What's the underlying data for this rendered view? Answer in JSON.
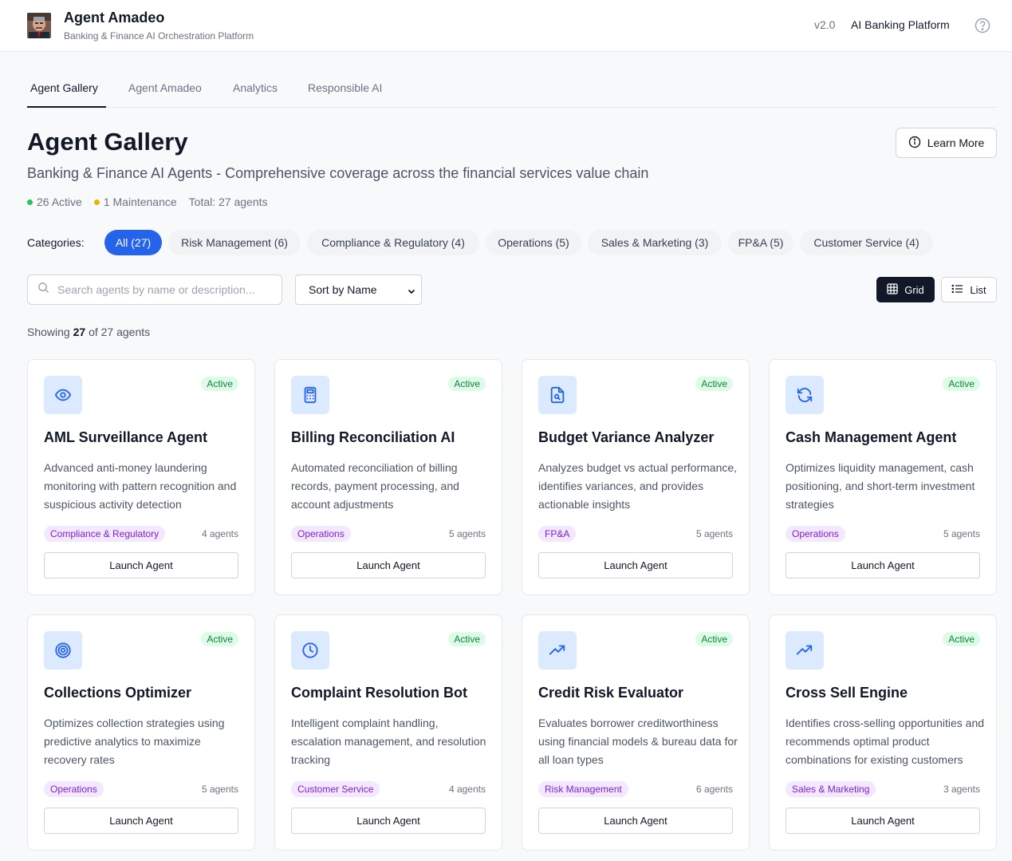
{
  "header": {
    "title": "Agent Amadeo",
    "subtitle": "Banking & Finance AI Orchestration Platform",
    "version": "v2.0",
    "platform": "AI Banking Platform"
  },
  "tabs": [
    {
      "label": "Agent Gallery",
      "active": true
    },
    {
      "label": "Agent Amadeo",
      "active": false
    },
    {
      "label": "Analytics",
      "active": false
    },
    {
      "label": "Responsible AI",
      "active": false
    }
  ],
  "page": {
    "title": "Agent Gallery",
    "description": "Banking & Finance AI Agents - Comprehensive coverage across the financial services value chain",
    "learn_more": "Learn More"
  },
  "stats": {
    "active": "26 Active",
    "maintenance": "1 Maintenance",
    "total": "Total: 27 agents",
    "active_color": "#22c55e",
    "maintenance_color": "#eab308"
  },
  "categories": {
    "label": "Categories:",
    "items": [
      {
        "label": "All (27)",
        "active": true
      },
      {
        "label": "Risk Management (6)",
        "active": false
      },
      {
        "label": "Compliance & Regulatory (4)",
        "active": false
      },
      {
        "label": "Operations (5)",
        "active": false
      },
      {
        "label": "Sales & Marketing (3)",
        "active": false
      },
      {
        "label": "FP&A (5)",
        "active": false
      },
      {
        "label": "Customer Service (4)",
        "active": false
      }
    ]
  },
  "search": {
    "placeholder": "Search agents by name or description...",
    "value": ""
  },
  "sort": {
    "label": "Sort by Name"
  },
  "view": {
    "grid": "Grid",
    "list": "List",
    "selected": "grid"
  },
  "showing": {
    "prefix": "Showing",
    "count": "27",
    "suffix": "of 27 agents"
  },
  "cards": [
    {
      "name": "AML Surveillance Agent",
      "status": "Active",
      "icon": "eye-icon",
      "description": "Advanced anti-money laundering monitoring with pattern recognition and suspicious activity detection",
      "category": "Compliance & Regulatory",
      "agents": "4 agents",
      "button": "Launch Agent"
    },
    {
      "name": "Billing Reconciliation AI",
      "status": "Active",
      "icon": "calculator-icon",
      "description": "Automated reconciliation of billing records, payment processing, and account adjustments",
      "category": "Operations",
      "agents": "5 agents",
      "button": "Launch Agent"
    },
    {
      "name": "Budget Variance Analyzer",
      "status": "Active",
      "icon": "file-search-icon",
      "description": "Analyzes budget vs actual performance, identifies variances, and provides actionable insights",
      "category": "FP&A",
      "agents": "5 agents",
      "button": "Launch Agent"
    },
    {
      "name": "Cash Management Agent",
      "status": "Active",
      "icon": "refresh-icon",
      "description": "Optimizes liquidity management, cash positioning, and short-term investment strategies",
      "category": "Operations",
      "agents": "5 agents",
      "button": "Launch Agent"
    },
    {
      "name": "Collections Optimizer",
      "status": "Active",
      "icon": "target-icon",
      "description": "Optimizes collection strategies using predictive analytics to maximize recovery rates",
      "category": "Operations",
      "agents": "5 agents",
      "button": "Launch Agent"
    },
    {
      "name": "Complaint Resolution Bot",
      "status": "Active",
      "icon": "clock-icon",
      "description": "Intelligent complaint handling, escalation management, and resolution tracking",
      "category": "Customer Service",
      "agents": "4 agents",
      "button": "Launch Agent"
    },
    {
      "name": "Credit Risk Evaluator",
      "status": "Active",
      "icon": "trending-up-icon",
      "description": "Evaluates borrower creditworthiness using financial models & bureau data for all loan types",
      "category": "Risk Management",
      "agents": "6 agents",
      "button": "Launch Agent"
    },
    {
      "name": "Cross Sell Engine",
      "status": "Active",
      "icon": "trending-up-icon",
      "description": "Identifies cross-selling opportunities and recommends optimal product combinations for existing customers",
      "category": "Sales & Marketing",
      "agents": "3 agents",
      "button": "Launch Agent"
    }
  ]
}
